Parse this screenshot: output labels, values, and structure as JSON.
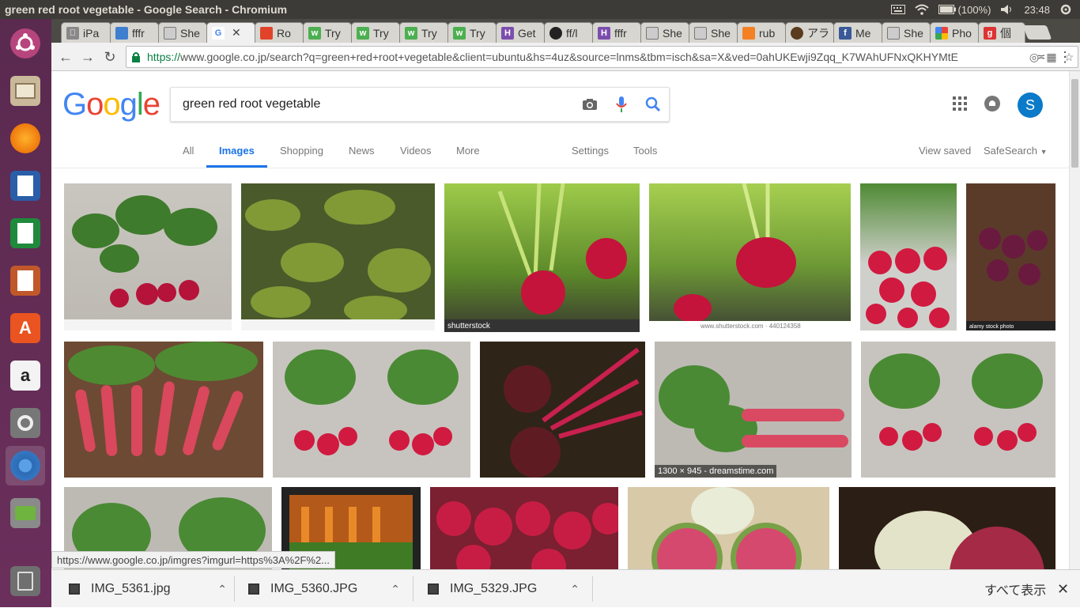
{
  "panel": {
    "title": "green red root vegetable - Google Search - Chromium",
    "battery": "(100%)",
    "time": "23:48"
  },
  "tabs": [
    {
      "label": "iPa",
      "icon": "apple-icon",
      "color": "#888"
    },
    {
      "label": "fffr",
      "icon": "page-icon",
      "color": "#3f7fd0"
    },
    {
      "label": "She",
      "icon": "document-icon",
      "color": "#999"
    },
    {
      "label": "",
      "icon": "google-icon",
      "color": "#4285f4"
    },
    {
      "label": "Ro",
      "icon": "feather-icon",
      "color": "#e0432a"
    },
    {
      "label": "Try",
      "icon": "w3-icon",
      "color": "#4caf50"
    },
    {
      "label": "Try",
      "icon": "w3-icon",
      "color": "#4caf50"
    },
    {
      "label": "Try",
      "icon": "w3-icon",
      "color": "#4caf50"
    },
    {
      "label": "Try",
      "icon": "w3-icon",
      "color": "#4caf50"
    },
    {
      "label": "Get",
      "icon": "h-icon",
      "color": "#7c4dad"
    },
    {
      "label": "ff/l",
      "icon": "github-icon",
      "color": "#222"
    },
    {
      "label": "fffr",
      "icon": "h-icon",
      "color": "#7c4dad"
    },
    {
      "label": "She",
      "icon": "document-icon",
      "color": "#999"
    },
    {
      "label": "She",
      "icon": "document-icon",
      "color": "#999"
    },
    {
      "label": "rub",
      "icon": "stack-icon",
      "color": "#f48024"
    },
    {
      "label": "アラ",
      "icon": "face-icon",
      "color": "#5a3b1e"
    },
    {
      "label": "Me",
      "icon": "facebook-icon",
      "color": "#3b5998"
    },
    {
      "label": "She",
      "icon": "document-icon",
      "color": "#999"
    },
    {
      "label": "Pho",
      "icon": "photos-icon",
      "color": "#fbbc05"
    },
    {
      "label": "個",
      "icon": "g-icon",
      "color": "#d33"
    }
  ],
  "omnibox": {
    "scheme": "https://",
    "url": "www.google.co.jp/search?q=green+red+root+vegetable&client=ubuntu&hs=4uz&source=lnms&tbm=isch&sa=X&ved=0ahUKEwji9Zqq_K7WAhUFNxQKHYMtE"
  },
  "search": {
    "logo": "Google",
    "query": "green red root vegetable"
  },
  "nav": {
    "all": "All",
    "images": "Images",
    "shopping": "Shopping",
    "news": "News",
    "videos": "Videos",
    "more": "More",
    "settings": "Settings",
    "tools": "Tools",
    "view_saved": "View saved",
    "safesearch": "SafeSearch"
  },
  "avatar_letter": "S",
  "results": {
    "caption_1": "1300 × 945 - dreamstime.com",
    "wm_shutterstock": "shutterstock",
    "wm_shutterstock_url": "www.shutterstock.com · 440124358",
    "wm_alamy": "alamy stock photo"
  },
  "status_url": "https://www.google.co.jp/imgres?imgurl=https%3A%2F%2...",
  "downloads": {
    "items": [
      "IMG_5361.jpg",
      "IMG_5360.JPG",
      "IMG_5329.JPG"
    ],
    "show_all": "すべて表示"
  }
}
